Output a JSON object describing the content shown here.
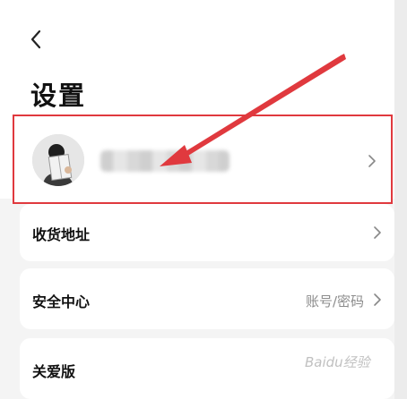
{
  "header": {
    "title": "设置",
    "back_icon": "chevron-left-icon"
  },
  "profile": {
    "avatar_icon": "avatar-reading-person",
    "username": "",
    "chevron_icon": "chevron-right-icon"
  },
  "menu": [
    {
      "label": "收货地址",
      "value": "",
      "chevron_icon": "chevron-right-icon"
    },
    {
      "label": "安全中心",
      "value": "账号/密码",
      "chevron_icon": "chevron-right-icon"
    },
    {
      "label": "关爱版",
      "value": ""
    }
  ],
  "annotation": {
    "highlight_color": "#e0393e",
    "arrow_color": "#e0393e"
  },
  "watermark": {
    "text": "Baidu经验"
  }
}
